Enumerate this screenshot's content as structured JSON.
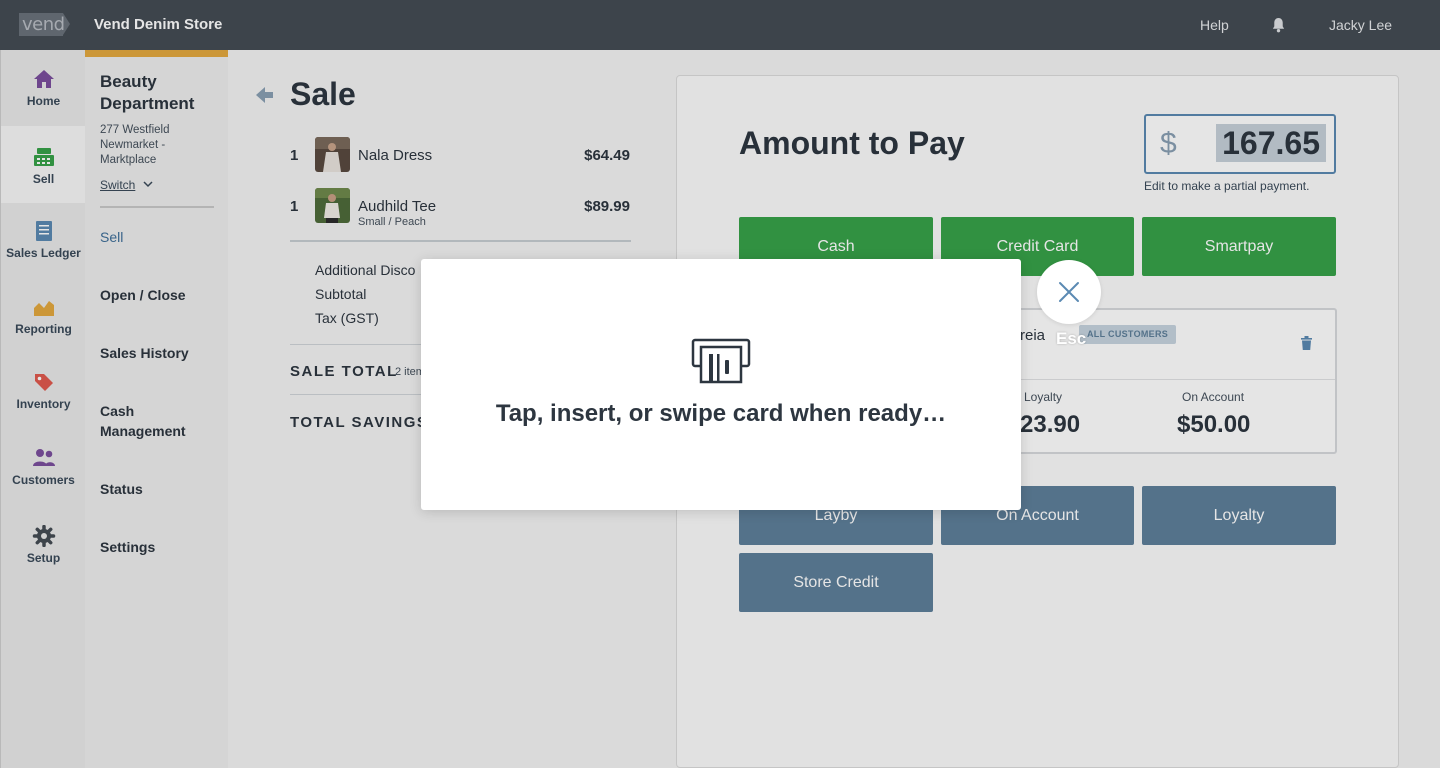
{
  "topbar": {
    "logo_text": "vend",
    "store_name": "Vend Denim Store",
    "help_label": "Help",
    "user_name": "Jacky Lee"
  },
  "rail": {
    "items": [
      {
        "label": "Home",
        "icon": "home-icon"
      },
      {
        "label": "Sell",
        "icon": "register-icon",
        "active": true
      },
      {
        "label": "Sales Ledger",
        "icon": "ledger-icon"
      },
      {
        "label": "Reporting",
        "icon": "chart-icon"
      },
      {
        "label": "Inventory",
        "icon": "tag-icon"
      },
      {
        "label": "Customers",
        "icon": "people-icon"
      },
      {
        "label": "Setup",
        "icon": "gear-icon"
      }
    ]
  },
  "outlet": {
    "name": "Beauty Department",
    "address_line1": "277 Westfield",
    "address_line2": "Newmarket -",
    "address_line3": "Marktplace",
    "switch_label": "Switch"
  },
  "subnav": {
    "items": [
      "Sell",
      "Open / Close",
      "Sales History",
      "Cash Management",
      "Status",
      "Settings"
    ]
  },
  "sale": {
    "title": "Sale",
    "lines": [
      {
        "qty": "1",
        "name": "Nala Dress",
        "variant": "",
        "price": "$64.49"
      },
      {
        "qty": "1",
        "name": "Audhild Tee",
        "variant": "Small / Peach",
        "price": "$89.99"
      }
    ],
    "additional_discount_label": "Additional Disco",
    "subtotal_label": "Subtotal",
    "tax_label": "Tax (GST)",
    "total_label": "SALE TOTAL",
    "total_count": "2 item",
    "savings_label": "TOTAL SAVINGS"
  },
  "payment": {
    "title": "Amount to Pay",
    "currency": "$",
    "amount": "167.65",
    "hint": "Edit to make a partial payment.",
    "buttons_top": [
      "Cash",
      "Credit Card",
      "Smartpay"
    ],
    "buttons_bottom": [
      "Layby",
      "On Account",
      "Loyalty",
      "Store Credit"
    ],
    "customer_name_fragment": "reia",
    "customer_badge": "ALL CUSTOMERS",
    "loyalty_label": "Loyalty",
    "loyalty_value": "23.90",
    "on_account_label": "On Account",
    "on_account_value": "$50.00"
  },
  "modal": {
    "message": "Tap, insert, or swipe card when ready…",
    "esc_label": "Esc"
  },
  "colors": {
    "topbar": "#444c54",
    "accent": "#e4a93f",
    "green": "#37a249",
    "blue": "#5e7f9a",
    "icon_purple": "#7b4f9e"
  }
}
